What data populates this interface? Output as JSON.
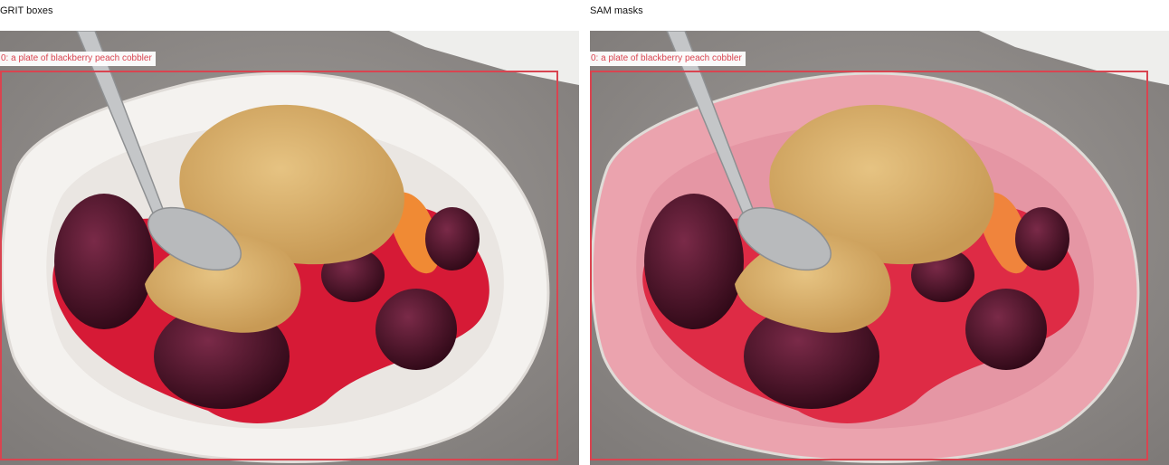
{
  "panels": [
    {
      "title": "GRIT boxes",
      "mode": "boxes",
      "detection": {
        "label": "0: a plate of blackberry peach cobbler",
        "color": "#d94450"
      }
    },
    {
      "title": "SAM masks",
      "mode": "masks",
      "detection": {
        "label": "0: a plate of blackberry peach cobbler",
        "color": "#d94450"
      },
      "mask_color": "#f27c90"
    }
  ],
  "colors": {
    "background_surface": "#8f8b89",
    "plate": "#f4f2ef",
    "crust": "#d9b06e",
    "berry": "#4a1228",
    "sauce": "#d61a36",
    "peach": "#f08a34",
    "spoon": "#c4c6c8"
  }
}
